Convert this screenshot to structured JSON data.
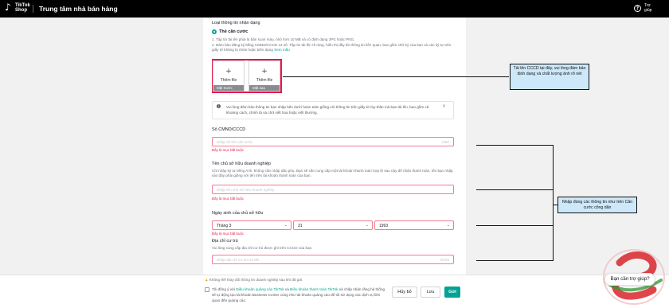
{
  "header": {
    "logo_line1": "TikTok",
    "logo_line2": "Shop",
    "title": "Trung tâm nhà bán hàng",
    "help_label": "Trợ giúp"
  },
  "id_type": {
    "label": "Loại thông tin nhận dạng",
    "option": "Thẻ căn cước",
    "rule1": "1. Tập tin tải lên phải là bản scan màu, nhỏ hơn 10 MB và có định dạng JPG hoặc PNG.",
    "rule2": "2. Đảm bảo đăng ký bằng CMND/CCCD 12 số. Tập tin tải lên rõ ràng, hiển thị đầy đủ thông tin liên quan, bao gồm chữ ký của bạn và các ký tự trên giấy tờ không bị nhòe hoặc biến dạng",
    "sample_link": "Xem mẫu"
  },
  "uploads": [
    {
      "plus": "+",
      "label": "Thêm file",
      "caption": "Mặt trước"
    },
    {
      "plus": "+",
      "label": "Thêm file",
      "caption": "Mặt sau"
    }
  ],
  "notice": {
    "icon": "info-icon",
    "text": "Vui lòng đảm bảo thông tin bạn nhập bên dưới hoàn toàn giống với thông tin trên giấy tờ tùy thân mà bạn tải lên, bao gồm cả khoảng cách, chính tả và chữ viết hoa hoặc viết thường.",
    "close": "×"
  },
  "id_number": {
    "label": "Số CMND/CCCD",
    "placeholder": "Nhập số thẻ căn cước",
    "counter": "0/50",
    "error": "Đây là mục bắt buộc"
  },
  "owner_name": {
    "label": "Tên chủ sở hữu doanh nghiệp",
    "hint": "Chỉ nhập ký tự tiếng Anh, không cần nhập dấu phụ. Bạn sẽ cần cung cấp một tài khoản thanh toán hợp lệ sau này để nhận thanh toán, tên bạn nhập vào đây phải giống với tên trên tài khoản thanh toán của bạn.",
    "placeholder": "Nhập tên chủ sở hữu doanh nghiệp",
    "error": "Đây là mục bắt buộc"
  },
  "birthday": {
    "label": "Ngày sinh của chủ sở hữu",
    "month": "Tháng 3",
    "day": "31",
    "year": "1993",
    "chevron": "⌄",
    "error": "Đây là mục bắt buộc"
  },
  "address": {
    "label": "Địa chỉ cư trú",
    "hint": "Vui lòng cung cấp địa chỉ cư trú được ghi trên CCCD của bạn.",
    "placeholder": "Nhập địa chỉ cư trú chi tiết",
    "counter": "0/200"
  },
  "annotations": {
    "upload_note": "Tải lên CCCD tại đây, vui lòng đảm bảo định dạng và chất lượng ảnh rõ nét",
    "fields_note": "Nhập đúng các thông tin như trên Căn cước công dân"
  },
  "footer": {
    "warning_icon": "▲",
    "warning": "Không thể thay đổi thông tin doanh nghiệp sau khi đã gửi.",
    "terms_prefix": "Tôi đồng ý với ",
    "terms_link1": "Điều khoản quảng cáo TikTok",
    "terms_mid": " và ",
    "terms_link2": "Điều khoản thanh toán TikTok",
    "terms_suffix": " và chấp nhận rằng hệ thống sẽ tự động tạo tài khoản Business Center cùng như tài khoản quảng cáo để tôi sử dụng các dịch vụ liên quan đến quảng cáo.",
    "cancel": "Hủy bỏ",
    "save": "Lưu",
    "submit": "Gửi"
  },
  "chat": {
    "label": "Bạn cần trợ giúp?"
  },
  "colors": {
    "accent": "#00a394",
    "error": "#e8174a",
    "callout": "#cde8f9"
  }
}
